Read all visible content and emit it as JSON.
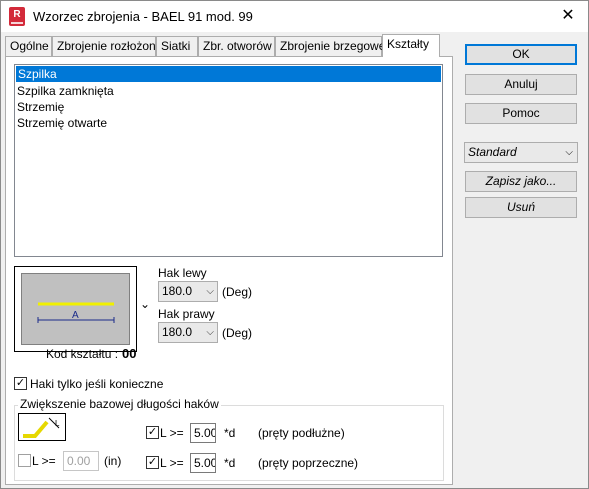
{
  "window": {
    "title": "Wzorzec zbrojenia - BAEL 91 mod. 99",
    "icon_letter": "R",
    "close_glyph": "✕"
  },
  "tabs": [
    {
      "label": "Ogólne"
    },
    {
      "label": "Zbrojenie rozłożone"
    },
    {
      "label": "Siatki"
    },
    {
      "label": "Zbr. otworów"
    },
    {
      "label": "Zbrojenie brzegowe"
    },
    {
      "label": "Kształty"
    }
  ],
  "active_tab": "Kształty",
  "shapes": {
    "items": [
      "Szpilka",
      "Szpilka zamknięta",
      "Strzemię",
      "Strzemię otwarte"
    ],
    "selected": "Szpilka"
  },
  "preview": {
    "dimension_label": "A",
    "code_label": "Kod kształtu :",
    "code_value": "00",
    "bar_color": "#f0f000"
  },
  "hooks": {
    "left_label": "Hak lewy",
    "left_value": "180.0",
    "left_unit": "(Deg)",
    "right_label": "Hak prawy",
    "right_value": "180.0",
    "right_unit": "(Deg)"
  },
  "only_if_needed": {
    "label": "Haki tylko jeśli konieczne",
    "checked": true
  },
  "increase_group": {
    "title": "Zwiększenie bazowej długości haków",
    "left_cb_label": "L >=",
    "left_value": "0.00",
    "left_unit": "(in)",
    "left_checked": false,
    "long_label": "L >=",
    "long_value": "5.00",
    "long_suffix": "*d",
    "long_desc": "(pręty podłużne)",
    "long_checked": true,
    "trans_label": "L >=",
    "trans_value": "5.00",
    "trans_suffix": "*d",
    "trans_desc": "(pręty poprzeczne)",
    "trans_checked": true
  },
  "buttons": {
    "ok": "OK",
    "cancel": "Anuluj",
    "help": "Pomoc",
    "save_as": "Zapisz jako...",
    "delete": "Usuń"
  },
  "style_select": {
    "value": "Standard"
  },
  "colors": {
    "selection": "#0078d7",
    "accent_border": "#0078d7",
    "brand_red": "#d32a3a"
  }
}
